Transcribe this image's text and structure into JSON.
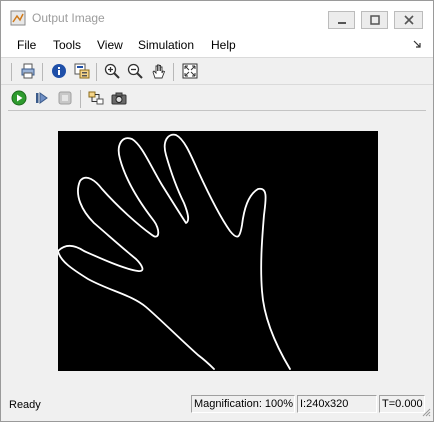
{
  "window": {
    "title": "Output Image"
  },
  "menu": [
    "File",
    "Tools",
    "View",
    "Simulation",
    "Help"
  ],
  "toolbar1": {
    "icons": [
      "print-icon",
      "info-icon",
      "properties-icon",
      "zoom-in-icon",
      "zoom-out-icon",
      "pan-hand-icon",
      "fit-to-window-icon"
    ]
  },
  "toolbar2": {
    "icons": [
      "run-icon",
      "step-forward-icon",
      "stop-icon",
      "highlight-block-icon",
      "snapshot-icon"
    ]
  },
  "status": {
    "ready": "Ready",
    "magnification": "Magnification: 100%",
    "size": "I:240x320",
    "time": "T=0.000"
  },
  "colors": {
    "image_bg": "#000000",
    "edge": "#ffffff",
    "run_green": "#2e9b2e",
    "info_blue": "#1e4fa8"
  }
}
